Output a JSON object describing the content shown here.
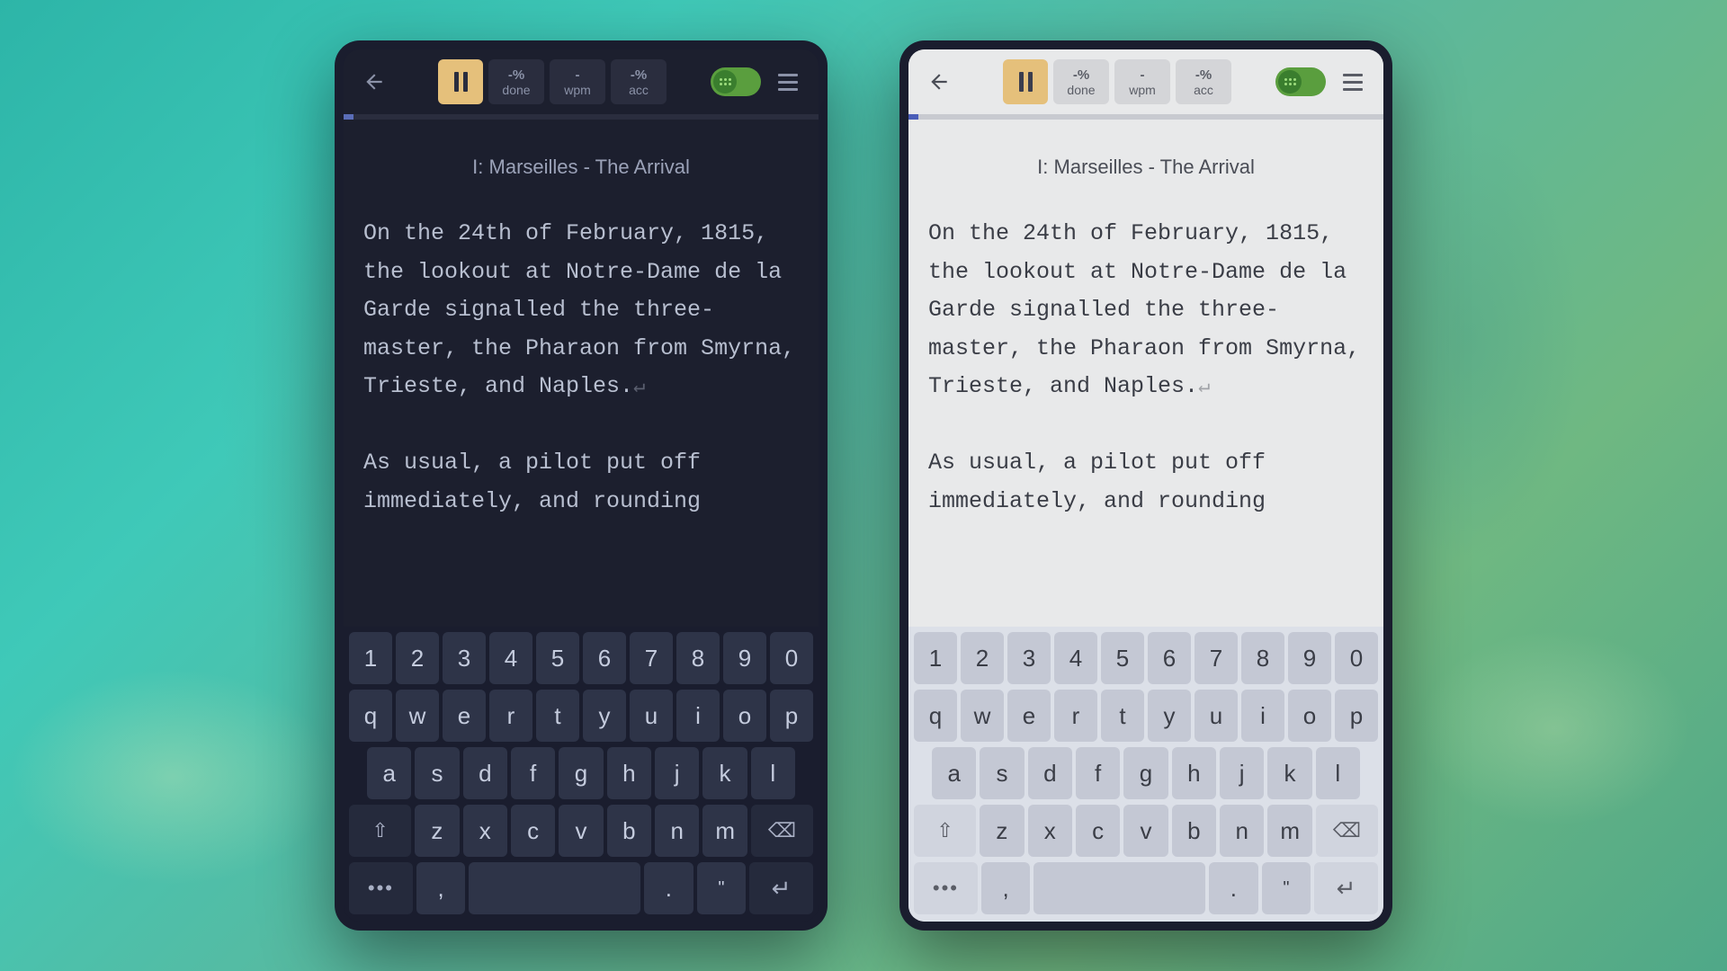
{
  "toolbar": {
    "stats": [
      {
        "value": "-%",
        "label": "done"
      },
      {
        "value": "-",
        "label": "wpm"
      },
      {
        "value": "-%",
        "label": "acc"
      }
    ]
  },
  "chapter_title": "I: Marseilles - The Arrival",
  "paragraphs": [
    "On the 24th of February, 1815, the lookout at Notre-Dame de la Garde signalled the three-master, the Pharaon from Smyrna, Trieste, and Naples.",
    "As usual, a pilot put off immediately, and rounding"
  ],
  "return_glyph": "↵",
  "keyboard": {
    "row1": [
      "1",
      "2",
      "3",
      "4",
      "5",
      "6",
      "7",
      "8",
      "9",
      "0"
    ],
    "row2": [
      "q",
      "w",
      "e",
      "r",
      "t",
      "y",
      "u",
      "i",
      "o",
      "p"
    ],
    "row3": [
      "a",
      "s",
      "d",
      "f",
      "g",
      "h",
      "j",
      "k",
      "l"
    ],
    "row4_letters": [
      "z",
      "x",
      "c",
      "v",
      "b",
      "n",
      "m"
    ],
    "more": "•••",
    "comma": ",",
    "period": ".",
    "quote": "\"",
    "shift": "⇧",
    "backspace": "⌫",
    "enter": "↵"
  }
}
